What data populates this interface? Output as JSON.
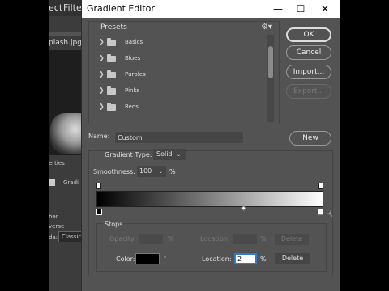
{
  "background": {
    "menu_items": [
      "ect",
      "Filter"
    ],
    "doc_tab": "plash.jpg @",
    "panel_labels": [
      "erties",
      "Gradi",
      "her",
      "verse",
      "da:"
    ],
    "mode_value": "Classic"
  },
  "dialog": {
    "title": "Gradient Editor",
    "window_buttons": {
      "minimize": "—",
      "maximize": "☐",
      "close": "✕"
    },
    "presets": {
      "heading": "Presets",
      "items": [
        {
          "label": "Basics"
        },
        {
          "label": "Blues"
        },
        {
          "label": "Purples"
        },
        {
          "label": "Pinks"
        },
        {
          "label": "Reds"
        }
      ]
    },
    "buttons": {
      "ok": "OK",
      "cancel": "Cancel",
      "import": "Import...",
      "export": "Export...",
      "new": "New"
    },
    "name": {
      "label": "Name:",
      "value": "Custom"
    },
    "gradient_type": {
      "label": "Gradient Type:",
      "value": "Solid"
    },
    "smoothness": {
      "label": "Smoothness:",
      "value": "100",
      "unit": "%"
    },
    "stops": {
      "heading": "Stops",
      "opacity_label": "Opacity:",
      "opacity_unit": "%",
      "opacity_location_label": "Location:",
      "opacity_location_unit": "%",
      "opacity_delete": "Delete",
      "color_label": "Color:",
      "color_location_label": "Location:",
      "color_location_value": "2",
      "color_location_unit": "%",
      "color_delete": "Delete"
    },
    "colors": {
      "selected_stop_color": "#000000",
      "gradient_start": "#000000",
      "gradient_end": "#ffffff"
    }
  }
}
